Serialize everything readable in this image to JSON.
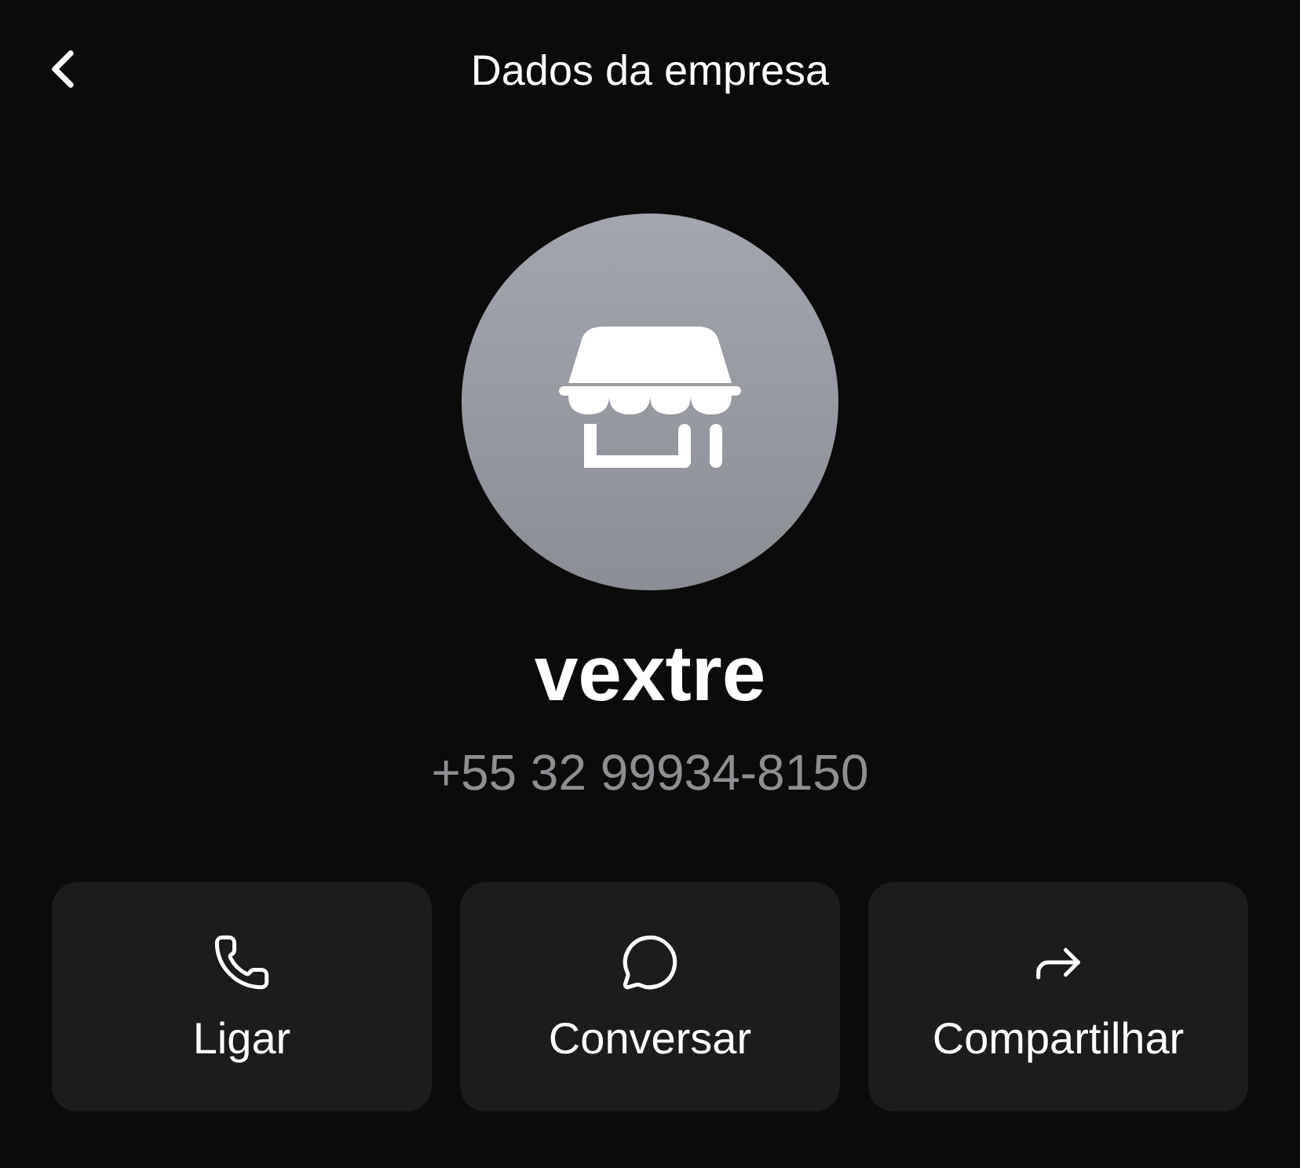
{
  "header": {
    "title": "Dados da empresa"
  },
  "profile": {
    "name": "vextre",
    "phone": "+55 32 99934-8150"
  },
  "actions": [
    {
      "kind": "call",
      "label": "Ligar"
    },
    {
      "kind": "chat",
      "label": "Conversar"
    },
    {
      "kind": "share",
      "label": "Compartilhar"
    }
  ]
}
